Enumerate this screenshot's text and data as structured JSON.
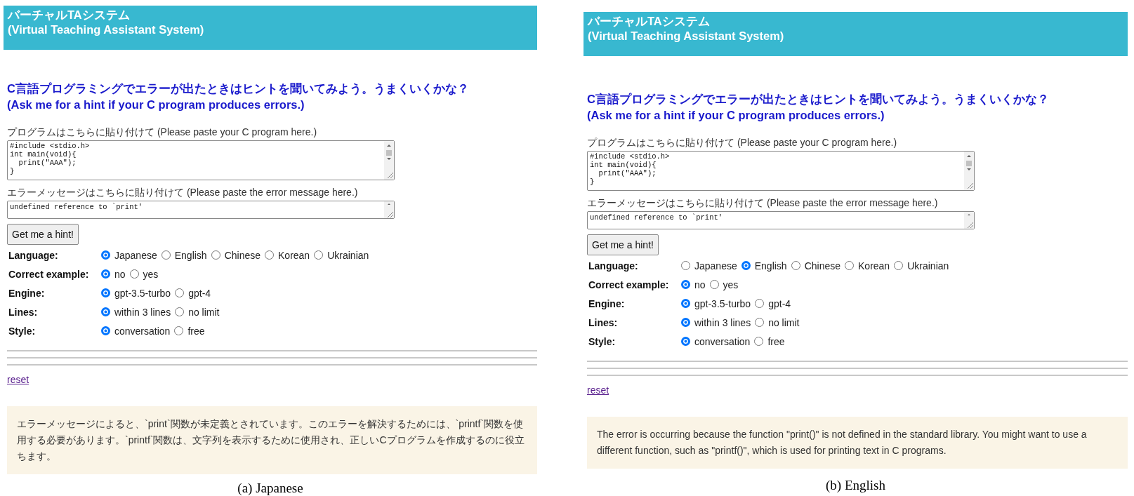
{
  "panels": [
    {
      "caption": "(a)  Japanese",
      "header": [
        "バーチャルTAシステム",
        "(Virtual Teaching Assistant System)"
      ],
      "heading": [
        "C言語プログラミングでエラーが出たときはヒントを聞いてみよう。うまくいくかな？",
        "(Ask me for a hint if your C program produces errors.)"
      ],
      "program_label": "プログラムはこちらに貼り付けて (Please paste your C program here.)",
      "program_code": "#include <stdio.h>\nint main(void){\n  print(\"AAA\");\n}",
      "error_label": "エラーメッセージはこちらに貼り付けて (Please paste the error message here.)",
      "error_value": "undefined reference to `print'",
      "button": "Get me a hint!",
      "options": [
        {
          "label": "Language:",
          "choices": [
            {
              "label": "Japanese",
              "selected": true
            },
            {
              "label": "English",
              "selected": false
            },
            {
              "label": "Chinese",
              "selected": false
            },
            {
              "label": "Korean",
              "selected": false
            },
            {
              "label": "Ukrainian",
              "selected": false
            }
          ]
        },
        {
          "label": "Correct example:",
          "choices": [
            {
              "label": "no",
              "selected": true
            },
            {
              "label": "yes",
              "selected": false
            }
          ]
        },
        {
          "label": "Engine:",
          "choices": [
            {
              "label": "gpt-3.5-turbo",
              "selected": true
            },
            {
              "label": "gpt-4",
              "selected": false
            }
          ]
        },
        {
          "label": "Lines:",
          "choices": [
            {
              "label": "within 3 lines",
              "selected": true
            },
            {
              "label": "no limit",
              "selected": false
            }
          ]
        },
        {
          "label": "Style:",
          "choices": [
            {
              "label": "conversation",
              "selected": true
            },
            {
              "label": "free",
              "selected": false
            }
          ]
        }
      ],
      "reset": "reset",
      "hint": "エラーメッセージによると、`print`関数が未定義とされています。このエラーを解決するためには、`printf`関数を使用する必要があります。`printf`関数は、文字列を表示するために使用され、正しいCプログラムを作成するのに役立ちます。"
    },
    {
      "caption": "(b)  English",
      "header": [
        "バーチャルTAシステム",
        "(Virtual Teaching Assistant System)"
      ],
      "heading": [
        "C言語プログラミングでエラーが出たときはヒントを聞いてみよう。うまくいくかな？",
        "(Ask me for a hint if your C program produces errors.)"
      ],
      "program_label": "プログラムはこちらに貼り付けて (Please paste your C program here.)",
      "program_code": "#include <stdio.h>\nint main(void){\n  print(\"AAA\");\n}",
      "error_label": "エラーメッセージはこちらに貼り付けて (Please paste the error message here.)",
      "error_value": "undefined reference to `print'",
      "button": "Get me a hint!",
      "options": [
        {
          "label": "Language:",
          "choices": [
            {
              "label": "Japanese",
              "selected": false
            },
            {
              "label": "English",
              "selected": true
            },
            {
              "label": "Chinese",
              "selected": false
            },
            {
              "label": "Korean",
              "selected": false
            },
            {
              "label": "Ukrainian",
              "selected": false
            }
          ]
        },
        {
          "label": "Correct example:",
          "choices": [
            {
              "label": "no",
              "selected": true
            },
            {
              "label": "yes",
              "selected": false
            }
          ]
        },
        {
          "label": "Engine:",
          "choices": [
            {
              "label": "gpt-3.5-turbo",
              "selected": true
            },
            {
              "label": "gpt-4",
              "selected": false
            }
          ]
        },
        {
          "label": "Lines:",
          "choices": [
            {
              "label": "within 3 lines",
              "selected": true
            },
            {
              "label": "no limit",
              "selected": false
            }
          ]
        },
        {
          "label": "Style:",
          "choices": [
            {
              "label": "conversation",
              "selected": true
            },
            {
              "label": "free",
              "selected": false
            }
          ]
        }
      ],
      "reset": "reset",
      "hint": "The error is occurring because the function \"print()\" is not defined in the standard library. You might want to use a different function, such as \"printf()\", which is used for printing text in C programs."
    }
  ]
}
